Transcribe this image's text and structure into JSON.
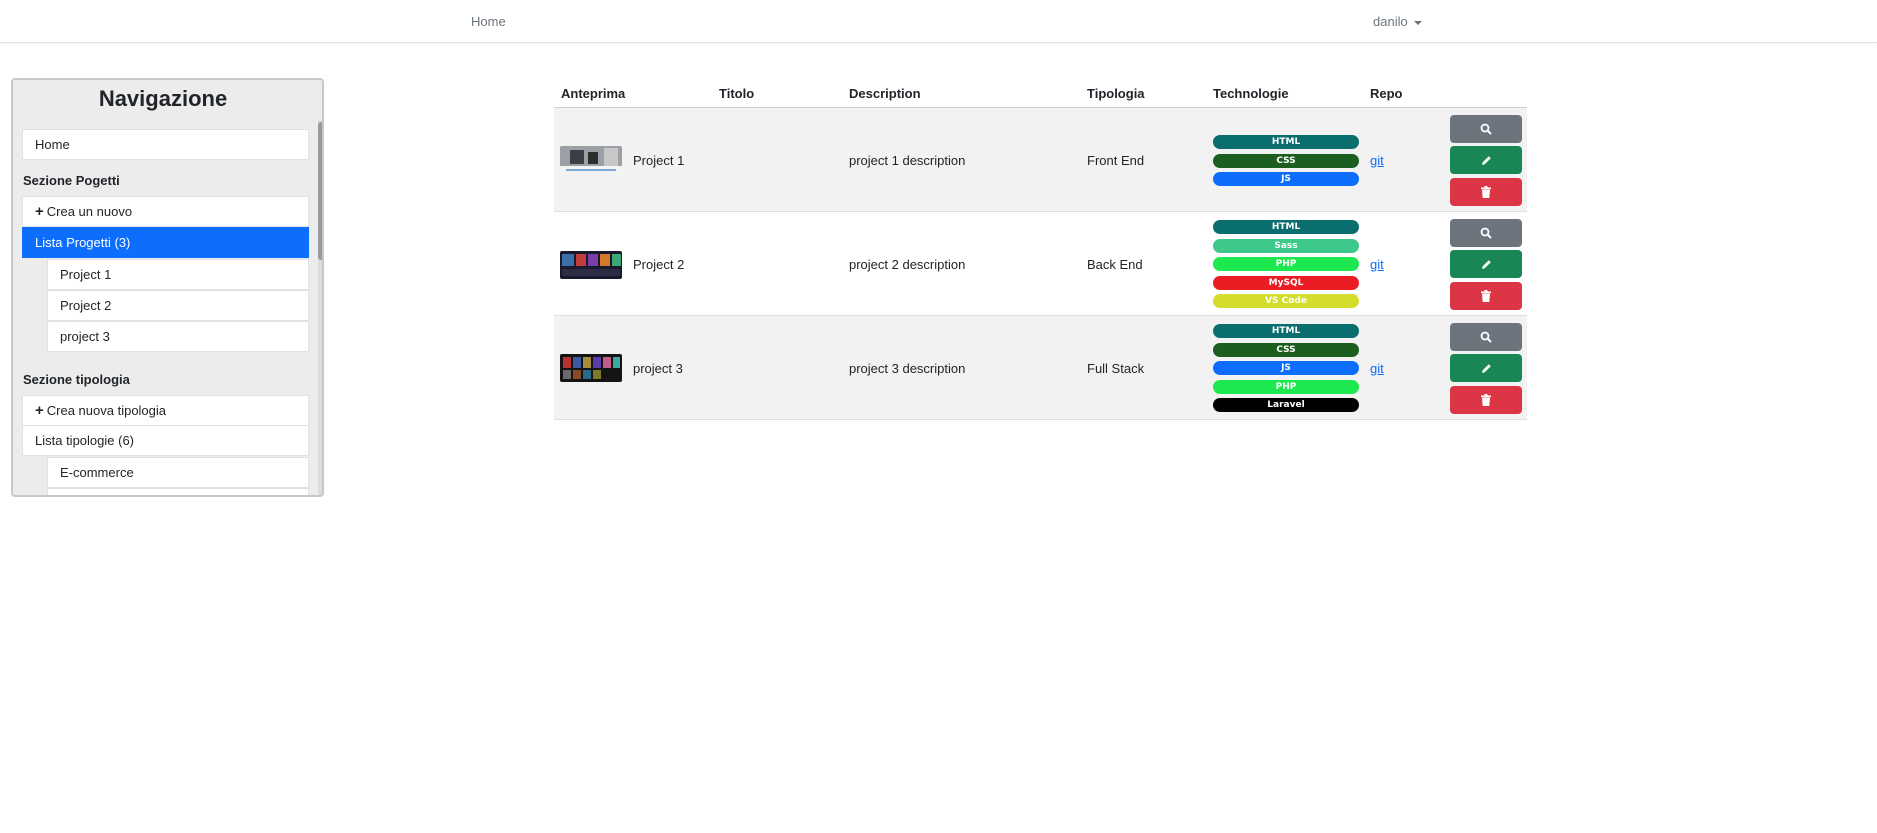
{
  "navbar": {
    "home": "Home",
    "user": "danilo"
  },
  "sidebar": {
    "title": "Navigazione",
    "home": "Home",
    "projects_section": "Sezione Pogetti",
    "create_project": "Crea un nuovo",
    "project_list": "Lista Progetti (3)",
    "projects": [
      "Project 1",
      "Project 2",
      "project 3"
    ],
    "types_section": "Sezione tipologia",
    "create_type": "Crea nuova tipologia",
    "type_list": "Lista tipologie (6)",
    "types": [
      "E-commerce"
    ]
  },
  "table": {
    "headers": [
      "Anteprima",
      "Titolo",
      "Description",
      "Tipologia",
      "Technologie",
      "Repo"
    ],
    "rows": [
      {
        "title": "Project 1",
        "description": "project 1 description",
        "type": "Front End",
        "repo": "git",
        "techs": [
          {
            "name": "HTML",
            "color": "#0b6e6e"
          },
          {
            "name": "CSS",
            "color": "#1b5e20"
          },
          {
            "name": "JS",
            "color": "#0d6efd"
          }
        ]
      },
      {
        "title": "Project 2",
        "description": "project 2 description",
        "type": "Back End",
        "repo": "git",
        "techs": [
          {
            "name": "HTML",
            "color": "#0b6e6e"
          },
          {
            "name": "Sass",
            "color": "#3ec88a"
          },
          {
            "name": "PHP",
            "color": "#1ee84f"
          },
          {
            "name": "MySQL",
            "color": "#ec1c24"
          },
          {
            "name": "VS Code",
            "color": "#d4dc2c"
          }
        ]
      },
      {
        "title": "project 3",
        "description": "project 3 description",
        "type": "Full Stack",
        "repo": "git",
        "techs": [
          {
            "name": "HTML",
            "color": "#0b6e6e"
          },
          {
            "name": "CSS",
            "color": "#1b5e20"
          },
          {
            "name": "JS",
            "color": "#0d6efd"
          },
          {
            "name": "PHP",
            "color": "#1ee84f"
          },
          {
            "name": "Laravel",
            "color": "#000000"
          }
        ]
      }
    ]
  },
  "icons": {
    "view": "search-icon",
    "edit": "pencil-icon",
    "delete": "trash-icon"
  }
}
